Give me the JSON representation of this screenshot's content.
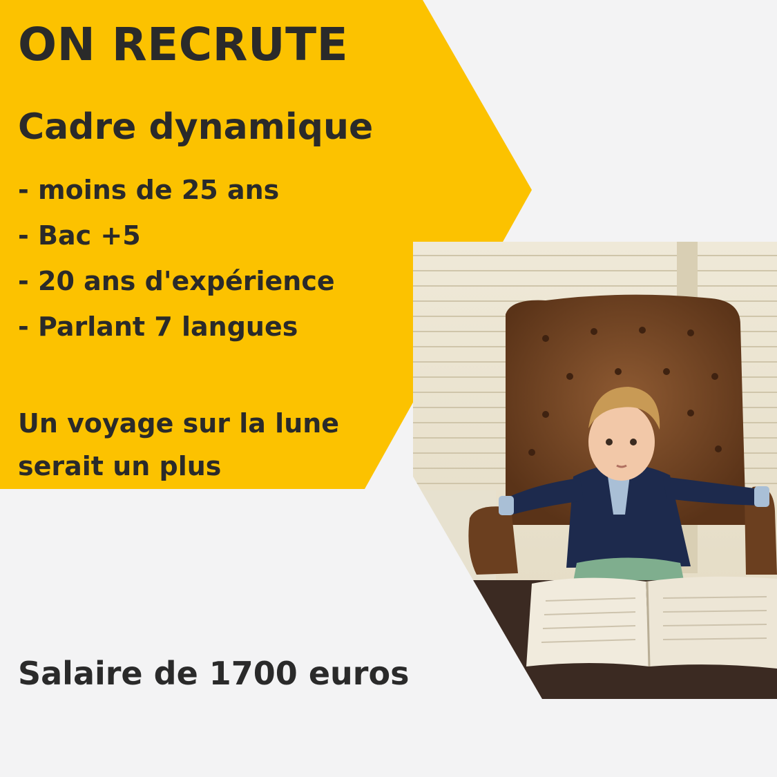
{
  "poster": {
    "headline": "ON RECRUTE",
    "subtitle": "Cadre dynamique",
    "requirements": [
      "- moins de 25 ans",
      "- Bac +5",
      "- 20 ans d'expérience",
      "- Parlant 7 langues"
    ],
    "bonus_lines": [
      "Un voyage sur la lune",
      "serait un plus"
    ],
    "salary": "Salaire de 1700 euros"
  },
  "colors": {
    "banner_yellow": "#fcc200",
    "background": "#f3f3f4",
    "text": "#2a2a2a"
  }
}
